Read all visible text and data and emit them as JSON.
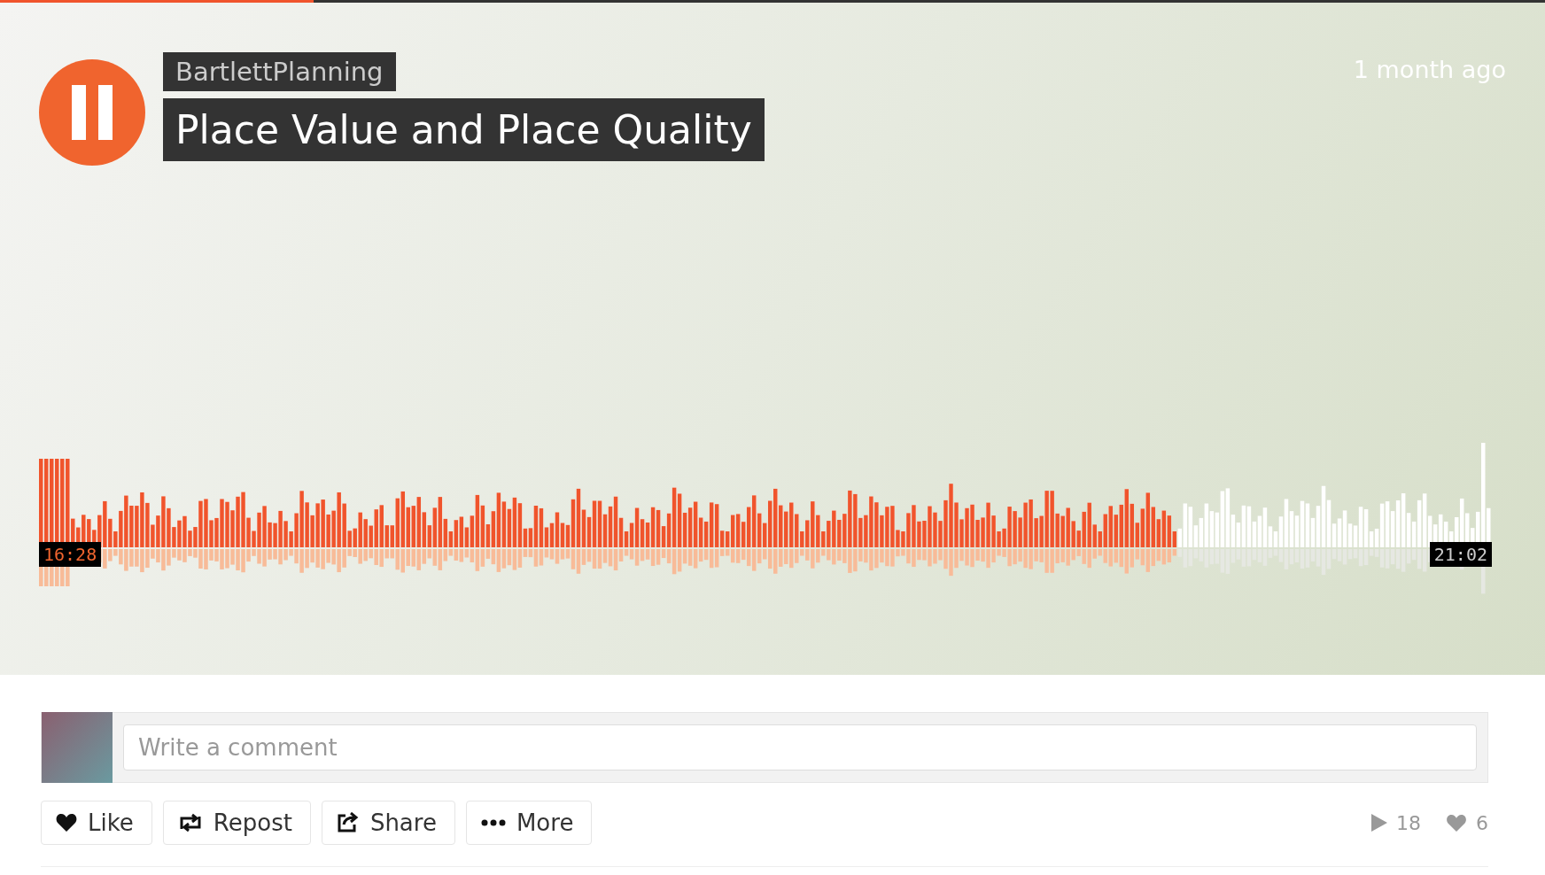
{
  "top_progress": {
    "level": 0.203
  },
  "track": {
    "uploader": "BartlettPlanning",
    "title": "Place Value and Place Quality",
    "posted": "1 month ago",
    "playing": true
  },
  "waveform": {
    "level": 0.783,
    "elapsed": "16:28",
    "duration": "21:02"
  },
  "comment": {
    "placeholder": "Write a comment"
  },
  "actions": [
    {
      "kind": "like",
      "label": "Like"
    },
    {
      "kind": "repost",
      "label": "Repost"
    },
    {
      "kind": "share",
      "label": "Share"
    },
    {
      "kind": "more",
      "label": "More"
    }
  ],
  "stats": [
    {
      "kind": "plays",
      "value": "18"
    },
    {
      "kind": "likes",
      "value": "6"
    }
  ]
}
